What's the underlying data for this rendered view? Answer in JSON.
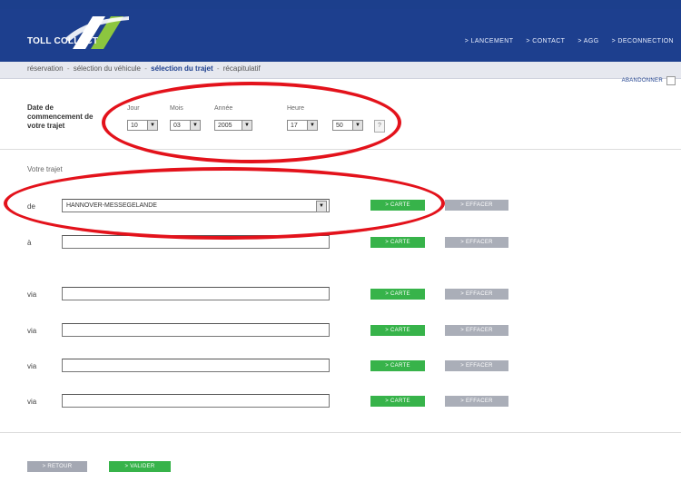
{
  "header": {
    "brand": "TOLL COLLECT",
    "nav": [
      "> LANCEMENT",
      "> CONTACT",
      "> AGG",
      "> DECONNECTION"
    ]
  },
  "breadcrumb": {
    "step1": "réservation",
    "step2": "sélection du véhicule",
    "step3": "sélection du trajet",
    "step4": "récapitulatif",
    "separator": "-"
  },
  "abandon": "ABANDONNER",
  "date_section": {
    "label": "Date de commencement de votre trajet",
    "jour_label": "Jour",
    "mois_label": "Mois",
    "annee_label": "Année",
    "heure_label": "Heure",
    "jour_value": "10",
    "mois_value": "03",
    "annee_value": "2005",
    "heure_value": "17",
    "minute_value": "50",
    "help": "?"
  },
  "route": {
    "title": "Votre trajet",
    "rows": [
      {
        "label": "de",
        "value": "HANNOVER-MESSEGELANDE"
      },
      {
        "label": "à",
        "value": ""
      },
      {
        "label": "via",
        "value": ""
      },
      {
        "label": "via",
        "value": ""
      },
      {
        "label": "via",
        "value": ""
      },
      {
        "label": "via",
        "value": ""
      }
    ],
    "carte_label": "> CARTE",
    "effacer_label": "> EFFACER"
  },
  "footer": {
    "retour": "> RETOUR",
    "valider": "> VALIDER"
  },
  "colors": {
    "header_blue": "#1d3f8e",
    "green": "#37b34a",
    "grey_button": "#aaaeb8",
    "annotation_red": "#e3121b"
  }
}
